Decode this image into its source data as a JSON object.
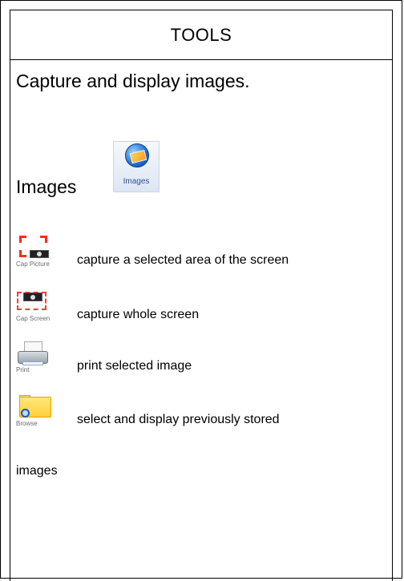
{
  "title": "TOOLS",
  "intro": "Capture and display images.",
  "images": {
    "label": "Images",
    "button_caption": "Images",
    "icon": "images-icon"
  },
  "tools": [
    {
      "caption": "Cap Picture",
      "description": "capture a selected area of the screen",
      "icon": "cap-picture-icon"
    },
    {
      "caption": "Cap Screen",
      "description": "capture whole screen",
      "icon": "cap-screen-icon"
    },
    {
      "caption": "Print",
      "description": "print selected image",
      "icon": "print-icon"
    },
    {
      "caption": "Browse",
      "description_line1": "select and display previously stored",
      "description_line2": "images",
      "icon": "browse-icon"
    }
  ],
  "colors": {
    "border": "#000000",
    "accent_red": "#ff2a1a",
    "accent_blue": "#2e4d9a",
    "folder_yellow": "#ffd54a"
  }
}
